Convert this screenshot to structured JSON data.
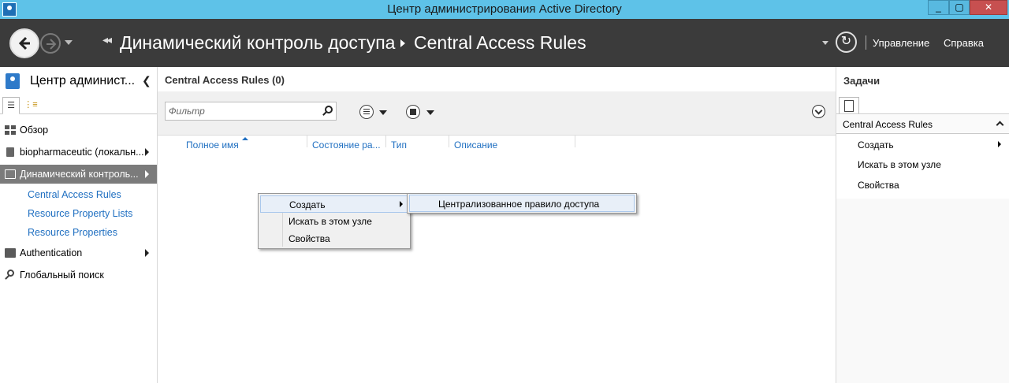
{
  "window": {
    "title": "Центр администрирования Active Directory"
  },
  "navbar": {
    "breadcrumb": [
      "Динамический контроль доступа",
      "Central Access Rules"
    ],
    "manage_label": "Управление",
    "help_label": "Справка"
  },
  "sidebar": {
    "title": "Центр админист...",
    "items": [
      {
        "label": "Обзор",
        "icon": "overview-icon"
      },
      {
        "label": "biopharmaceutic (локальн...",
        "icon": "domain-icon"
      },
      {
        "label": "Динамический контроль...",
        "icon": "folder-icon",
        "selected": true
      },
      {
        "label": "Authentication",
        "icon": "folder-icon"
      },
      {
        "label": "Глобальный поиск",
        "icon": "search-icon"
      }
    ],
    "subitems": [
      "Central Access Rules",
      "Resource Property Lists",
      "Resource Properties"
    ]
  },
  "main": {
    "title": "Central Access Rules  (0)",
    "filter_placeholder": "Фильтр",
    "columns": [
      "Полное имя",
      "Состояние ра...",
      "Тип",
      "Описание"
    ]
  },
  "context_menu": {
    "items": [
      "Создать",
      "Искать в этом узле",
      "Свойства"
    ],
    "submenu": [
      "Централизованное правило доступа"
    ]
  },
  "tasks": {
    "title": "Задачи",
    "section": "Central Access Rules",
    "items": [
      "Создать",
      "Искать в этом узле",
      "Свойства"
    ]
  },
  "colors": {
    "titlebar": "#5ec2e8",
    "navbar": "#3b3b3b",
    "link": "#1f6fc1",
    "selected": "#7b7b7b"
  }
}
